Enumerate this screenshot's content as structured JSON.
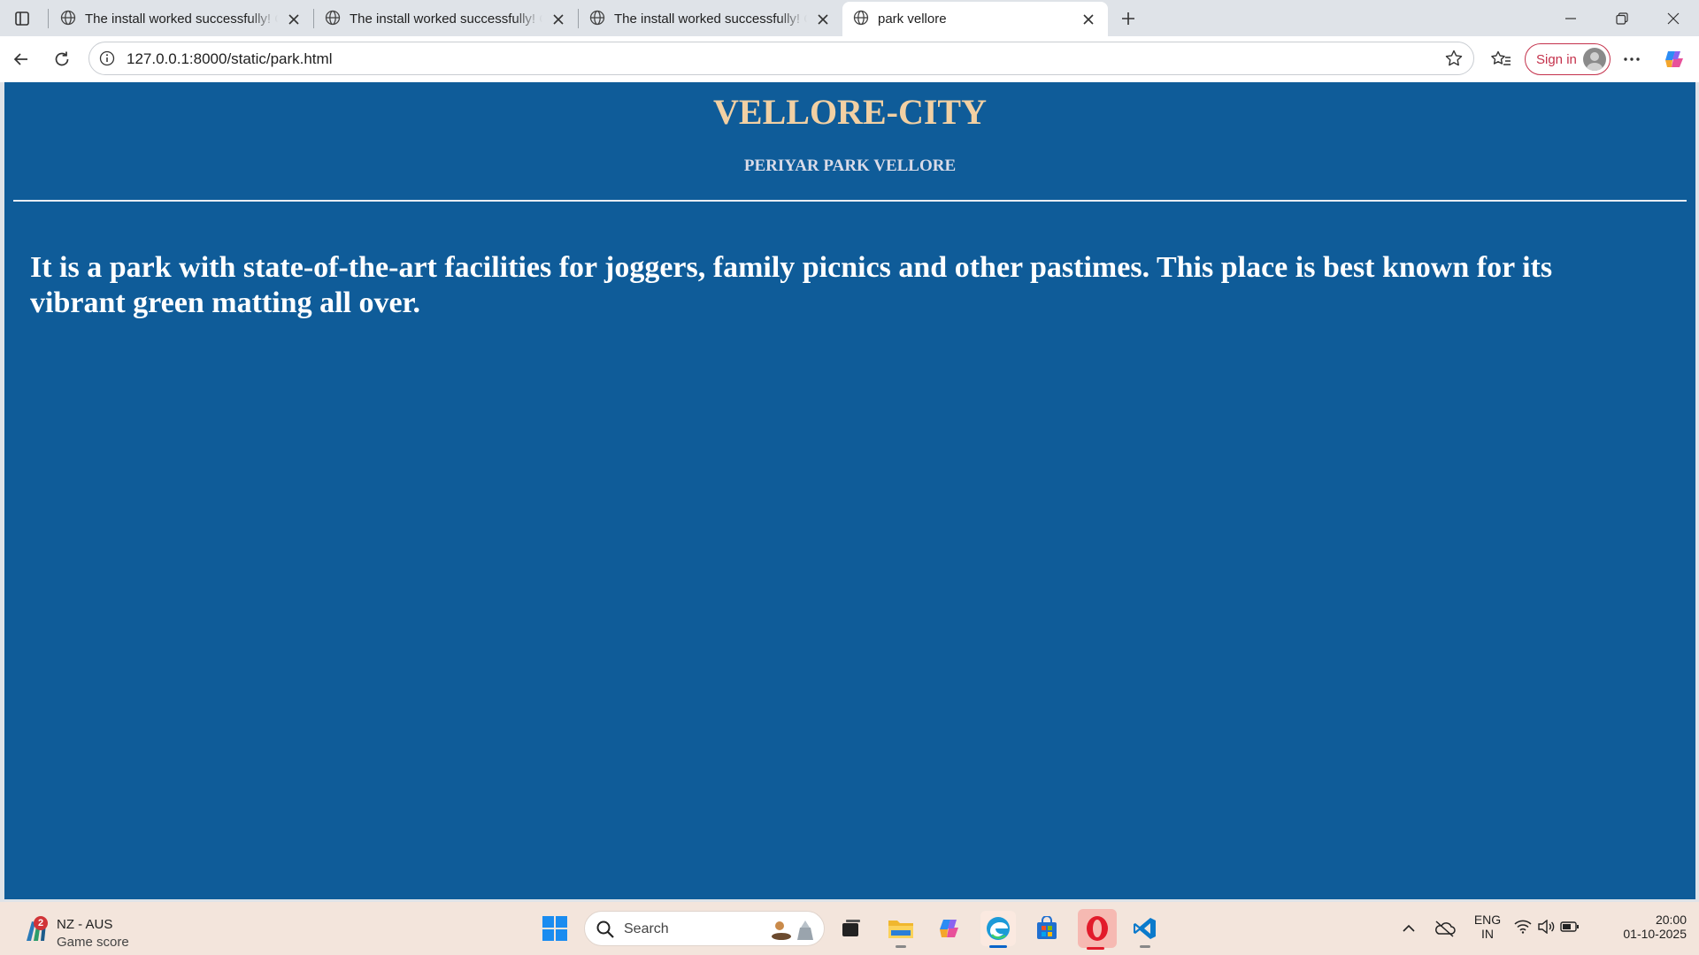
{
  "browser": {
    "tabs": [
      {
        "title": "The install worked successfully! Congratulations!",
        "active": false
      },
      {
        "title": "The install worked successfully! Congratulations!",
        "active": false
      },
      {
        "title": "The install worked successfully! Congratulations!",
        "active": false
      },
      {
        "title": "park vellore",
        "active": true
      }
    ],
    "address": {
      "url": "127.0.0.1:8000/static/park.html"
    },
    "signin_label": "Sign in"
  },
  "page": {
    "title": "VELLORE-CITY",
    "subtitle": "PERIYAR PARK VELLORE",
    "body": "It is a park with state-of-the-art facilities for joggers, family picnics and other pastimes. This place is best known for its vibrant green matting all over."
  },
  "taskbar": {
    "weather": {
      "line1": "NZ - AUS",
      "line2": "Game score",
      "badge": "2"
    },
    "search_label": "Search",
    "tray": {
      "lang_line1": "ENG",
      "lang_line2": "IN",
      "time": "20:00",
      "date": "01-10-2025"
    }
  },
  "colors": {
    "page_background": "#0f5c99",
    "title": "#f2d0a3",
    "signin_accent": "#c4314b"
  }
}
